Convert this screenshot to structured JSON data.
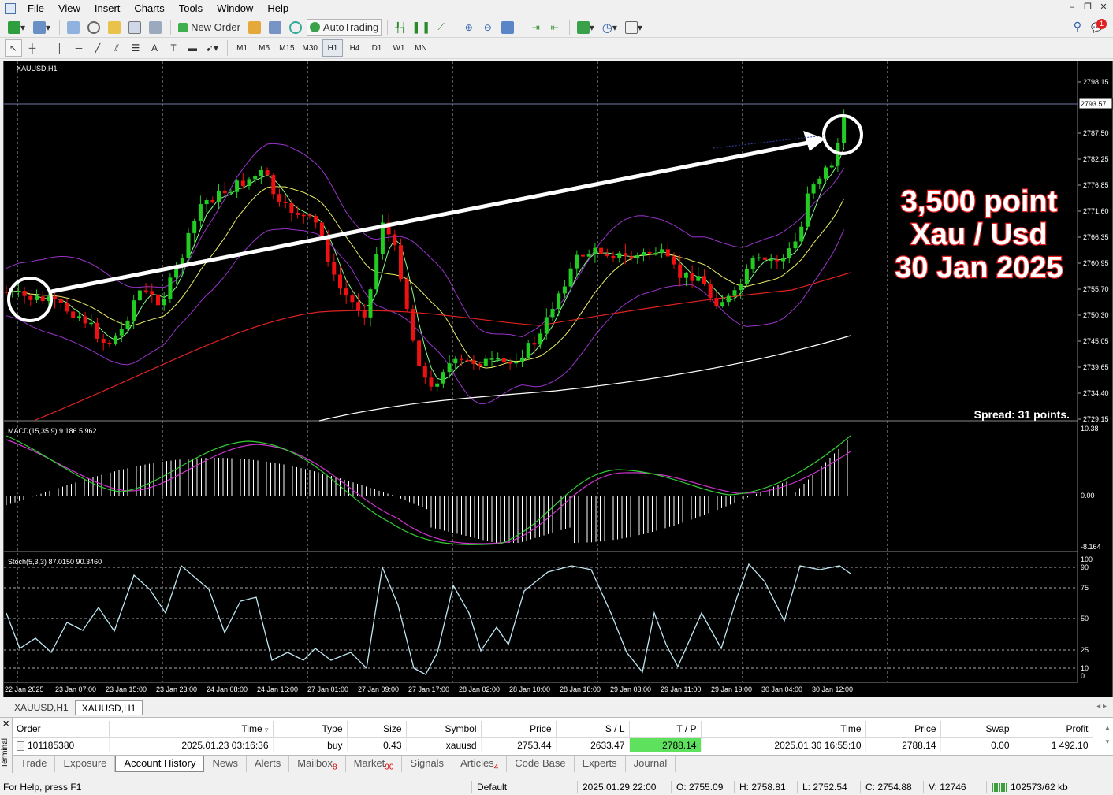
{
  "menu": [
    "File",
    "View",
    "Insert",
    "Charts",
    "Tools",
    "Window",
    "Help"
  ],
  "toolbar": {
    "new_order": "New Order",
    "auto_trading": "AutoTrading"
  },
  "timeframes": [
    "M1",
    "M5",
    "M15",
    "M30",
    "H1",
    "H4",
    "D1",
    "W1",
    "MN"
  ],
  "active_timeframe": "H1",
  "chart": {
    "symbol_label": "XAUUSD,H1",
    "macd_label": "MACD(15,35,9) 9.186 5.962",
    "stoch_label": "Stoch(5,3,3) 87.0150 90.3460",
    "spread": "Spread: 31 points.",
    "current_price": "2793.57",
    "annotation": [
      "3,500 point",
      "Xau / Usd",
      "30 Jan 2025"
    ],
    "price_ticks": [
      "2798.15",
      "2787.50",
      "2782.25",
      "2776.85",
      "2771.60",
      "2766.35",
      "2760.95",
      "2755.70",
      "2750.30",
      "2745.05",
      "2739.65",
      "2734.40",
      "2729.15"
    ],
    "macd_ticks": [
      "10.38",
      "0.00",
      "-8.164"
    ],
    "stoch_ticks": [
      "100",
      "90",
      "75",
      "50",
      "25",
      "10",
      "0"
    ],
    "time_ticks": [
      "22 Jan 2025",
      "23 Jan 07:00",
      "23 Jan 15:00",
      "23 Jan 23:00",
      "24 Jan 08:00",
      "24 Jan 16:00",
      "27 Jan 01:00",
      "27 Jan 09:00",
      "27 Jan 17:00",
      "28 Jan 02:00",
      "28 Jan 10:00",
      "28 Jan 18:00",
      "29 Jan 03:00",
      "29 Jan 11:00",
      "29 Jan 19:00",
      "30 Jan 04:00",
      "30 Jan 12:00"
    ],
    "colors": {
      "bull": "#22cc22",
      "bear": "#ee1111",
      "bands": "#9933cc",
      "ma_slow": "#dd2222",
      "ma_long": "#ffffff",
      "ma_mid": "#eeee66",
      "macd_signal": "#cc33cc",
      "macd_line": "#33cc33",
      "stoch": "#bfe7f2"
    }
  },
  "chart_tabs": [
    "XAUUSD,H1",
    "XAUUSD,H1"
  ],
  "history": {
    "headers": [
      "Order",
      "Time",
      "Type",
      "Size",
      "Symbol",
      "Price",
      "S / L",
      "T / P",
      "Time",
      "Price",
      "Swap",
      "Profit"
    ],
    "row": [
      "101185380",
      "2025.01.23 03:16:36",
      "buy",
      "0.43",
      "xauusd",
      "2753.44",
      "2633.47",
      "2788.14",
      "2025.01.30 16:55:10",
      "2788.14",
      "0.00",
      "1 492.10"
    ]
  },
  "terminal_label": "Terminal",
  "terminal_tabs": [
    {
      "label": "Trade",
      "badge": ""
    },
    {
      "label": "Exposure",
      "badge": ""
    },
    {
      "label": "Account History",
      "badge": ""
    },
    {
      "label": "News",
      "badge": ""
    },
    {
      "label": "Alerts",
      "badge": ""
    },
    {
      "label": "Mailbox",
      "badge": "8"
    },
    {
      "label": "Market",
      "badge": "90"
    },
    {
      "label": "Signals",
      "badge": ""
    },
    {
      "label": "Articles",
      "badge": "4"
    },
    {
      "label": "Code Base",
      "badge": ""
    },
    {
      "label": "Experts",
      "badge": ""
    },
    {
      "label": "Journal",
      "badge": ""
    }
  ],
  "status": {
    "help": "For Help, press F1",
    "profile": "Default",
    "datetime": "2025.01.29 22:00",
    "open": "O: 2755.09",
    "high": "H: 2758.81",
    "low": "L: 2752.54",
    "close": "C: 2754.88",
    "volume": "V: 12746",
    "traffic": "102573/62 kb"
  },
  "notification_count": "1"
}
